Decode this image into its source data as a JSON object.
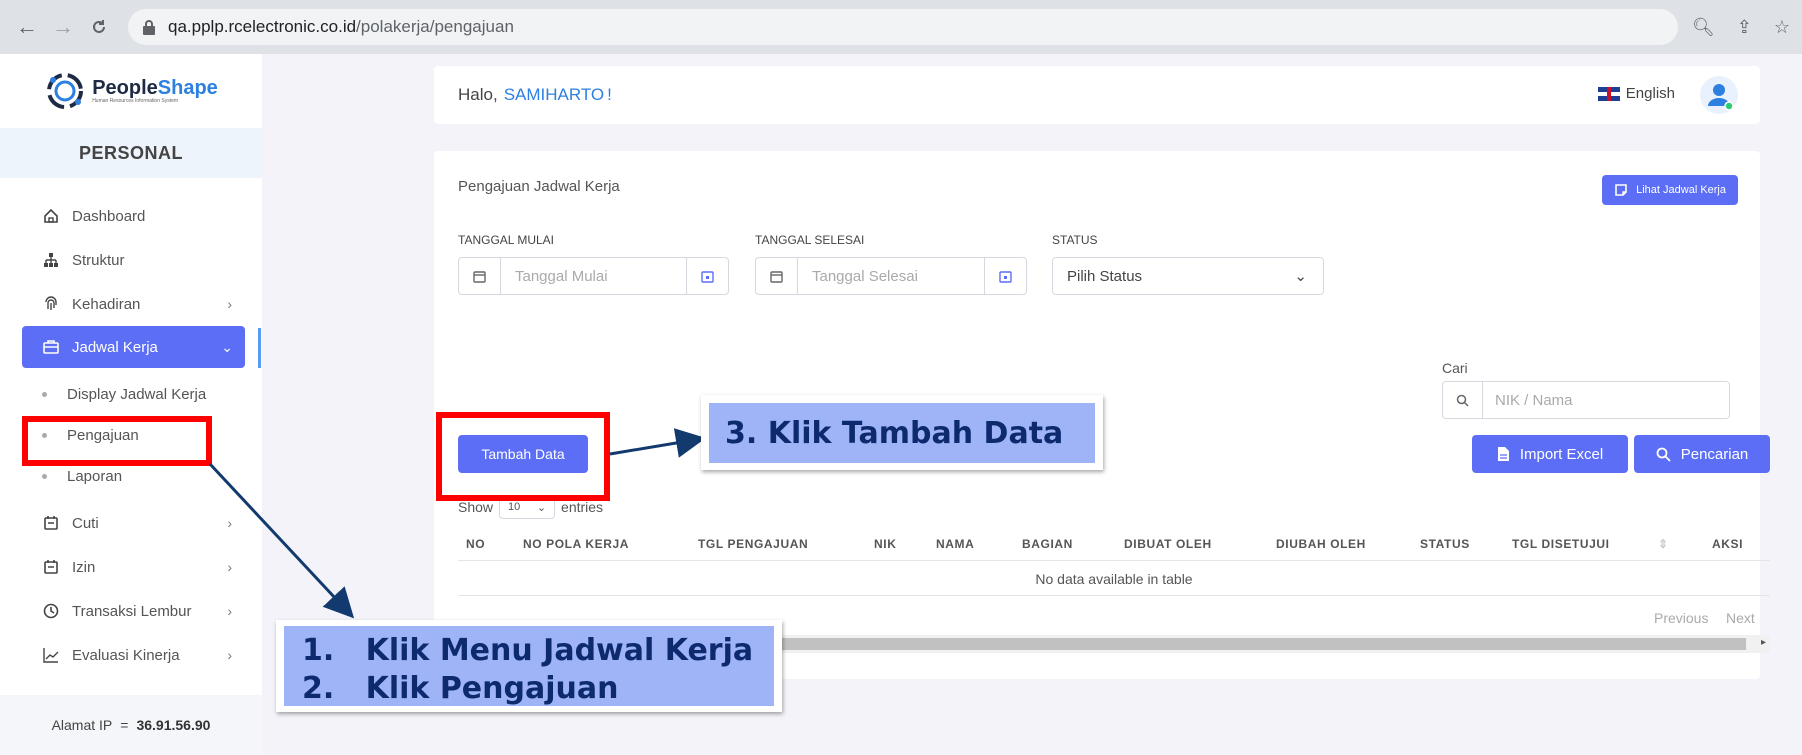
{
  "browser": {
    "url_host": "qa.pplp.rcelectronic.co.id",
    "url_path": "/polakerja/pengajuan"
  },
  "sidebar": {
    "logo_name_a": "People",
    "logo_name_b": "Shape",
    "logo_sub": "Human Resources Information System",
    "section": "PERSONAL",
    "items": [
      {
        "label": "Dashboard",
        "icon": "home-icon"
      },
      {
        "label": "Struktur",
        "icon": "org-chart-icon"
      },
      {
        "label": "Kehadiran",
        "icon": "fingerprint-icon"
      },
      {
        "label": "Jadwal Kerja",
        "icon": "briefcase-icon"
      },
      {
        "label": "Cuti",
        "icon": "calendar-icon"
      },
      {
        "label": "Izin",
        "icon": "calendar-icon"
      },
      {
        "label": "Transaksi Lembur",
        "icon": "clock-icon"
      },
      {
        "label": "Evaluasi Kinerja",
        "icon": "chart-line-icon"
      }
    ],
    "sub_items": [
      "Display Jadwal Kerja",
      "Pengajuan",
      "Laporan"
    ],
    "ip_label": "Alamat IP",
    "ip_sep": "=",
    "ip_value": "36.91.56.90"
  },
  "topbar": {
    "greeting": "Halo,",
    "user": "SAMIHARTO",
    "suffix": "!",
    "language": "English"
  },
  "card": {
    "title": "Pengajuan Jadwal Kerja",
    "lihat_button": "Lihat Jadwal Kerja",
    "labels": {
      "start": "TANGGAL MULAI",
      "end": "TANGGAL SELESAI",
      "status": "STATUS"
    },
    "placeholders": {
      "start": "Tanggal Mulai",
      "end": "Tanggal Selesai",
      "status": "Pilih Status",
      "search": "NIK / Nama"
    },
    "cari_label": "Cari",
    "tambah_button": "Tambah Data",
    "import_button": "Import Excel",
    "search_button": "Pencarian",
    "show": "Show",
    "entries_value": "10",
    "entries": "entries",
    "columns": [
      "NO",
      "NO POLA KERJA",
      "TGL PENGAJUAN",
      "NIK",
      "NAMA",
      "BAGIAN",
      "DIBUAT OLEH",
      "DIUBAH OLEH",
      "STATUS",
      "TGL DISETUJUI",
      "AKSI"
    ],
    "no_data": "No data available in table",
    "previous": "Previous",
    "next": "Next"
  },
  "annotations": {
    "step3": "3. Klik Tambah Data",
    "step1": "1.   Klik Menu Jadwal Kerja",
    "step2": "2.   Klik Pengajuan",
    "highlight_color": "#ff0000",
    "callout_color": "#9fb4f7"
  },
  "colors": {
    "primary": "#5b6ef5",
    "link": "#2d7fe0"
  }
}
